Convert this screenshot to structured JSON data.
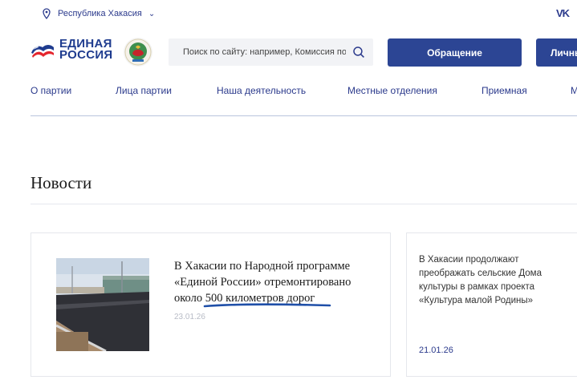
{
  "topbar": {
    "region": "Республика Хакасия",
    "social": "VK"
  },
  "logo": {
    "line1": "ЕДИНАЯ",
    "line2": "РОССИЯ"
  },
  "search": {
    "placeholder": "Поиск по сайту: например, Комиссия по эт"
  },
  "buttons": {
    "appeal": "Обращение",
    "cabinet": "Личный"
  },
  "nav": {
    "items": [
      "О партии",
      "Лица партии",
      "Наша деятельность",
      "Местные отделения",
      "Приемная",
      "М"
    ]
  },
  "news": {
    "title": "Новости",
    "items": [
      {
        "headline": "В Хакасии по Народной программе «Единой России» отремонтировано около 500 километров дорог",
        "date": "23.01.26"
      },
      {
        "headline": "В Хакасии продолжают преображать сельские Дома культуры в рамках проекта «Культура малой Родины»",
        "date": "21.01.26"
      }
    ]
  },
  "colors": {
    "brand": "#2c4594",
    "underline": "#1f4fa8"
  }
}
